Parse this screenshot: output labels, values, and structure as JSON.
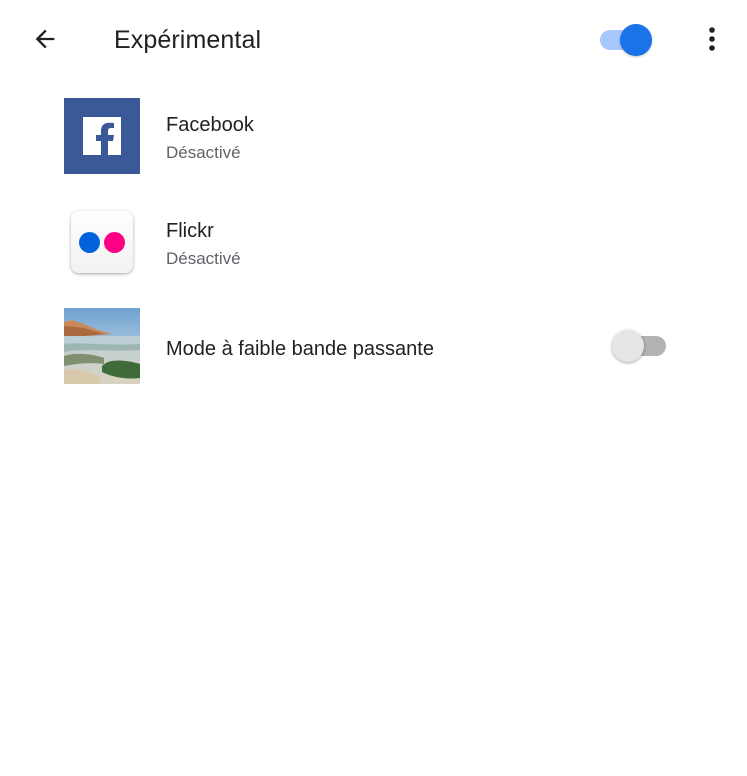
{
  "appbar": {
    "title": "Expérimental",
    "master_toggle_on": true,
    "icons": {
      "back": "arrow-back-icon",
      "menu": "more-vert-icon"
    }
  },
  "items": [
    {
      "title": "Facebook",
      "status": "Désactivé",
      "icon": "facebook-logo"
    },
    {
      "title": "Flickr",
      "status": "Désactivé",
      "icon": "flickr-logo"
    },
    {
      "title": "Mode à faible bande passante",
      "icon": "landscape-thumbnail",
      "toggle_on": false
    }
  ],
  "colors": {
    "accent": "#1a73e8",
    "accent_track": "#a8c7fa",
    "facebook": "#3b5998",
    "flickr_blue": "#0063dc",
    "flickr_pink": "#ff0084"
  }
}
